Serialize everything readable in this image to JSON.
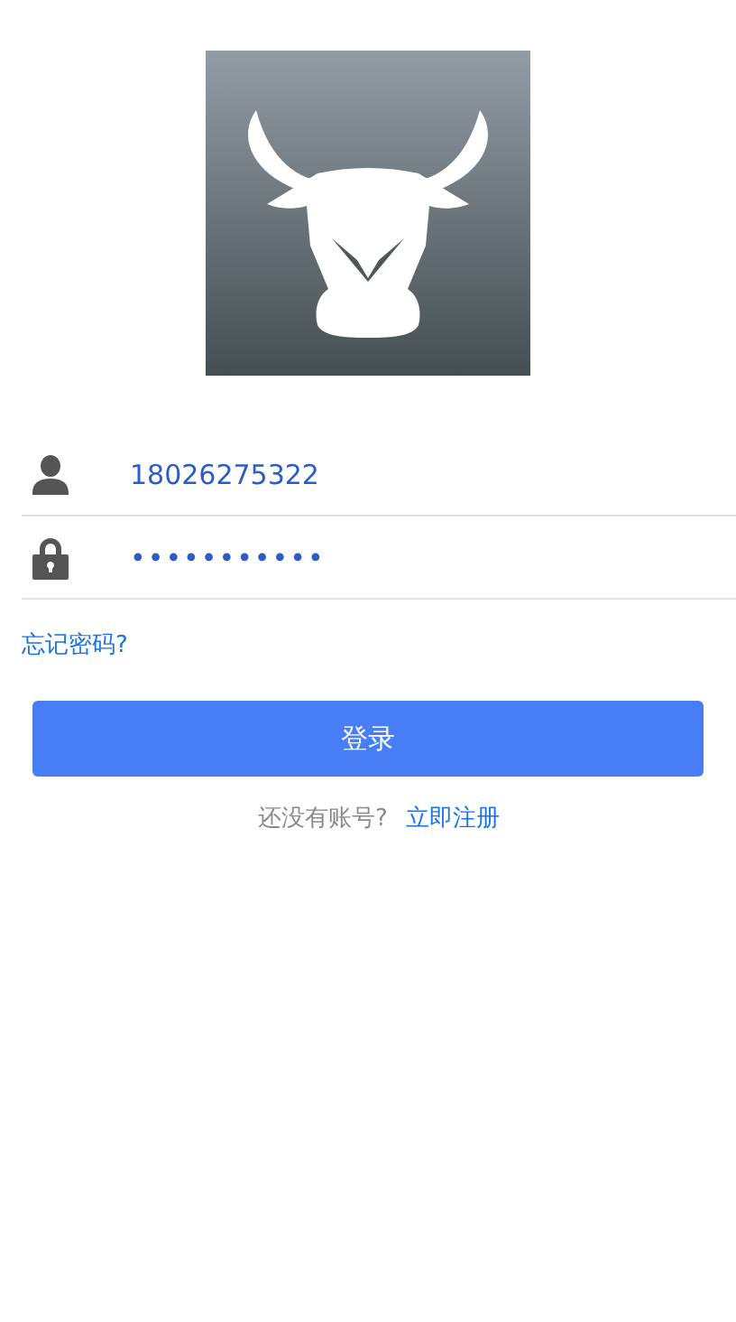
{
  "login_form": {
    "fields": [
      {
        "kind": "user",
        "value": "18026275322"
      },
      {
        "kind": "password",
        "value": "•••••••••••"
      }
    ],
    "forgot_link": "忘记密码?",
    "submit_button": "登录",
    "register_prompt": "还没有账号?",
    "register_link": "立即注册"
  }
}
